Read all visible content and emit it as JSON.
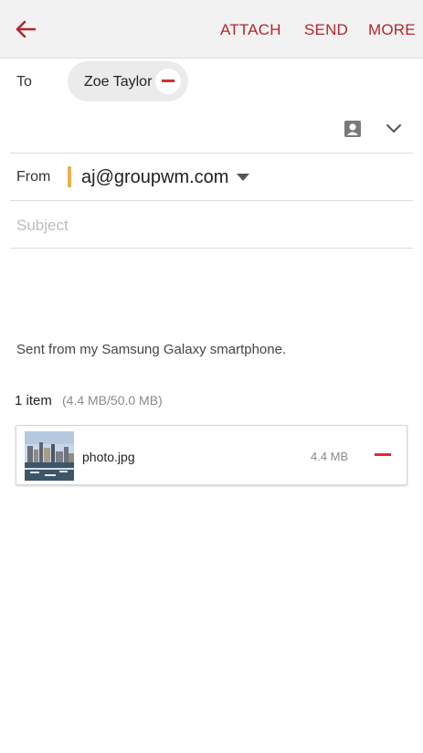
{
  "toolbar": {
    "back_icon": "arrow-left-icon",
    "attach_label": "ATTACH",
    "send_label": "SEND",
    "more_label": "MORE",
    "accent_color": "#b3262d"
  },
  "recipients": {
    "to_label": "To",
    "chips": [
      {
        "name": "Zoe Taylor",
        "remove_icon": "minus-circle-icon"
      }
    ],
    "contacts_icon": "contact-book-icon",
    "expand_icon": "chevron-down-icon"
  },
  "from": {
    "label": "From",
    "account_color": "#e8b04a",
    "value": "aj@groupwm.com",
    "dropdown_icon": "triangle-down-icon"
  },
  "subject": {
    "placeholder": "Subject",
    "value": ""
  },
  "body": {
    "signature": "Sent from my Samsung Galaxy smartphone."
  },
  "attachments": {
    "count_label": "1 item",
    "size_label": "(4.4 MB/50.0 MB)",
    "items": [
      {
        "file_name": "photo.jpg",
        "file_size": "4.4 MB",
        "remove_icon": "minus-icon"
      }
    ]
  }
}
